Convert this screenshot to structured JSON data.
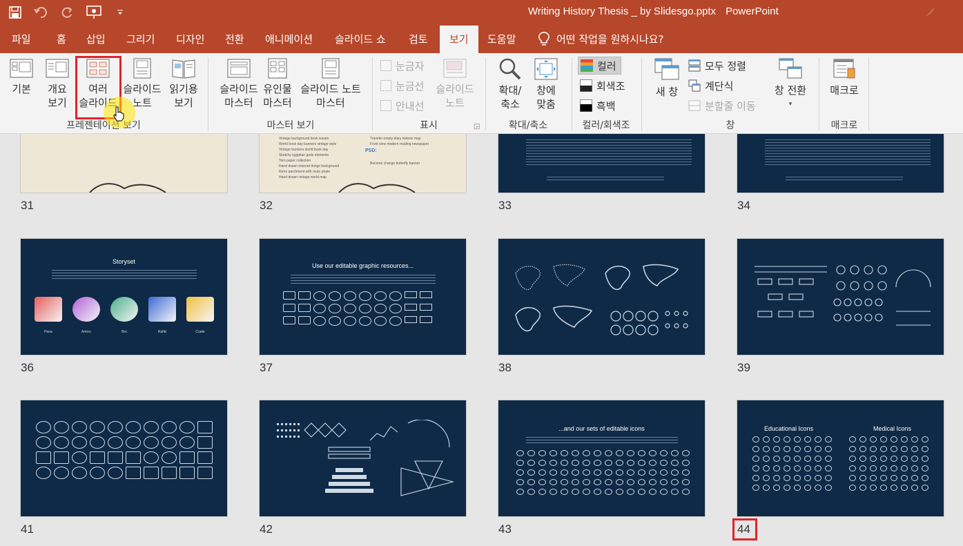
{
  "window": {
    "title": "Writing History Thesis _ by Slidesgo.pptx",
    "app": "PowerPoint"
  },
  "qat": {
    "save_icon": "save-icon",
    "undo_icon": "undo-icon",
    "redo_icon": "redo-icon",
    "present_icon": "present-from-start-icon",
    "customize_icon": "customize-qat-icon"
  },
  "tabs": [
    {
      "label": "파일"
    },
    {
      "label": "홈"
    },
    {
      "label": "삽입"
    },
    {
      "label": "그리기"
    },
    {
      "label": "디자인"
    },
    {
      "label": "전환"
    },
    {
      "label": "애니메이션"
    },
    {
      "label": "슬라이드 쇼"
    },
    {
      "label": "검토"
    },
    {
      "label": "보기"
    },
    {
      "label": "도움말"
    }
  ],
  "tellme": "어떤 작업을 원하시나요?",
  "ribbon": {
    "presentation_views": {
      "label": "프레젠테이션 보기",
      "normal": [
        "기본"
      ],
      "outline": [
        "개요",
        "보기"
      ],
      "sorter": [
        "여러",
        "슬라이드"
      ],
      "notes": [
        "슬라이드",
        "노트"
      ],
      "reading": [
        "읽기용",
        "보기"
      ]
    },
    "master_views": {
      "label": "마스터 보기",
      "slide_master": [
        "슬라이드",
        "마스터"
      ],
      "handout_master": [
        "유인물",
        "마스터"
      ],
      "notes_master": [
        "슬라이드 노트",
        "마스터"
      ]
    },
    "show": {
      "label": "표시",
      "ruler": "눈금자",
      "gridlines": "눈금선",
      "guides": "안내선",
      "notes": [
        "슬라이드",
        "노트"
      ]
    },
    "zoom": {
      "label": "확대/축소",
      "zoom": [
        "확대/",
        "축소"
      ],
      "fit": [
        "창에",
        "맞춤"
      ]
    },
    "color": {
      "label": "컬러/회색조",
      "color": "컬러",
      "grayscale": "회색조",
      "bw": "흑백"
    },
    "window": {
      "label": "창",
      "new_window": "새 창",
      "arrange_all": "모두 정렬",
      "cascade": "계단식",
      "move_split": "분할줄 이동",
      "switch": "창 전환"
    },
    "macros": {
      "label": "매크로",
      "macros": "매크로"
    }
  },
  "slides_row1": [
    {
      "num": "31"
    },
    {
      "num": "32"
    },
    {
      "num": "33"
    },
    {
      "num": "34"
    }
  ],
  "slides_row2": [
    {
      "num": "36",
      "title": "Storyset",
      "names": [
        "Pana",
        "Amico",
        "Bro",
        "Rafiki",
        "Cuate"
      ]
    },
    {
      "num": "37",
      "title": "Use our editable graphic resources..."
    },
    {
      "num": "38"
    },
    {
      "num": "39"
    }
  ],
  "slides_row3": [
    {
      "num": "41"
    },
    {
      "num": "42"
    },
    {
      "num": "43",
      "title": "...and our sets of editable icons"
    },
    {
      "num": "44",
      "title_left": "Educational Icons",
      "title_right": "Medical Icons"
    }
  ],
  "slide32": {
    "list": [
      "Vintage background book issues",
      "World book day banners vintage style",
      "Vintage banners world book day",
      "Sketchy egyptian gods elements",
      "Torn paper collection",
      "Hand drawn internet things background",
      "Retro parchment with route pirate",
      "Hand drawn vintage world map"
    ],
    "list_right": [
      "Traveler empty diary historic map",
      "Front view modern reading newspaper"
    ],
    "psd_label": "PSD:",
    "psd_item": "Become change butterfly banner"
  },
  "colors": {
    "accent": "#b7472a",
    "slide_bg": "#0e2a47",
    "highlight": "#e0232a"
  }
}
